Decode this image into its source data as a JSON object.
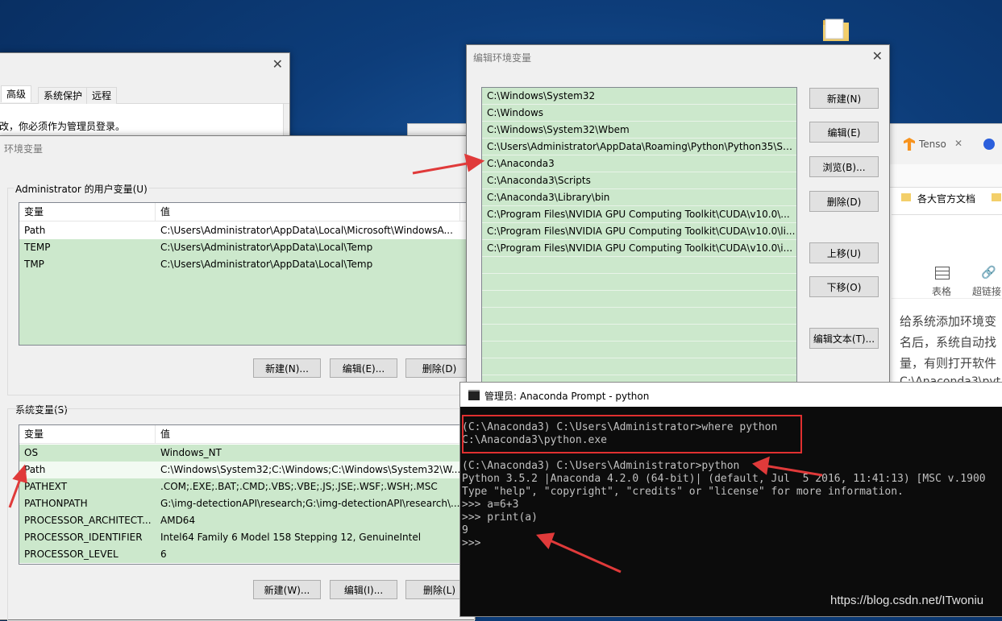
{
  "system_props": {
    "tabs": [
      "高级",
      "系统保护",
      "远程"
    ],
    "notice": "改，你必须作为管理员登录。"
  },
  "env_dialog": {
    "title": "环境变量",
    "user_group_label": "Administrator 的用户变量(U)",
    "col_var": "变量",
    "col_val": "值",
    "user_vars": [
      {
        "name": "Path",
        "value": "C:\\Users\\Administrator\\AppData\\Local\\Microsoft\\WindowsA..."
      },
      {
        "name": "TEMP",
        "value": "C:\\Users\\Administrator\\AppData\\Local\\Temp"
      },
      {
        "name": "TMP",
        "value": "C:\\Users\\Administrator\\AppData\\Local\\Temp"
      }
    ],
    "user_buttons": [
      "新建(N)...",
      "编辑(E)...",
      "删除(D)"
    ],
    "sys_group_label": "系统变量(S)",
    "sys_vars": [
      {
        "name": "OS",
        "value": "Windows_NT"
      },
      {
        "name": "Path",
        "value": "C:\\Windows\\System32;C:\\Windows;C:\\Windows\\System32\\W..."
      },
      {
        "name": "PATHEXT",
        "value": ".COM;.EXE;.BAT;.CMD;.VBS;.VBE;.JS;.JSE;.WSF;.WSH;.MSC"
      },
      {
        "name": "PATHONPATH",
        "value": "G:\\img-detectionAPI\\research;G:\\img-detectionAPI\\research\\..."
      },
      {
        "name": "PROCESSOR_ARCHITECT...",
        "value": "AMD64"
      },
      {
        "name": "PROCESSOR_IDENTIFIER",
        "value": "Intel64 Family 6 Model 158 Stepping 12, GenuineIntel"
      },
      {
        "name": "PROCESSOR_LEVEL",
        "value": "6"
      }
    ],
    "sys_buttons": [
      "新建(W)...",
      "编辑(I)...",
      "删除(L)"
    ]
  },
  "edit_dialog": {
    "title": "编辑环境变量",
    "paths": [
      "C:\\Windows\\System32",
      "C:\\Windows",
      "C:\\Windows\\System32\\Wbem",
      "C:\\Users\\Administrator\\AppData\\Roaming\\Python\\Python35\\Scr...",
      "C:\\Anaconda3",
      "C:\\Anaconda3\\Scripts",
      "C:\\Anaconda3\\Library\\bin",
      "C:\\Program Files\\NVIDIA GPU Computing Toolkit\\CUDA\\v10.0\\...",
      "C:\\Program Files\\NVIDIA GPU Computing Toolkit\\CUDA\\v10.0\\li...",
      "C:\\Program Files\\NVIDIA GPU Computing Toolkit\\CUDA\\v10.0\\i..."
    ],
    "buttons": [
      "新建(N)",
      "编辑(E)",
      "浏览(B)...",
      "删除(D)",
      "上移(U)",
      "下移(O)",
      "编辑文本(T)..."
    ]
  },
  "console": {
    "title": "管理员: Anaconda Prompt - python",
    "lines": [
      "(C:\\Anaconda3) C:\\Users\\Administrator>where python",
      "C:\\Anaconda3\\python.exe",
      "",
      "(C:\\Anaconda3) C:\\Users\\Administrator>python",
      "Python 3.5.2 |Anaconda 4.2.0 (64-bit)| (default, Jul  5 2016, 11:41:13) [MSC v.1900",
      "Type \"help\", \"copyright\", \"credits\" or \"license\" for more information.",
      ">>> a=6+3",
      ">>> print(a)",
      "9",
      ">>> "
    ]
  },
  "browser": {
    "tab_text": "Tenso",
    "bookmark": "各大官方文档",
    "toolbar": [
      "表格",
      "超链接"
    ],
    "article_lines": [
      "给系统添加环境变",
      "名后，系统自动找",
      "量，有则打开软件",
      "C:\\Anaconda3\\pyt"
    ]
  },
  "watermark": "https://blog.csdn.net/ITwoniu",
  "colors": {
    "highlight": "#e03030",
    "selection": "#cce8cc"
  }
}
